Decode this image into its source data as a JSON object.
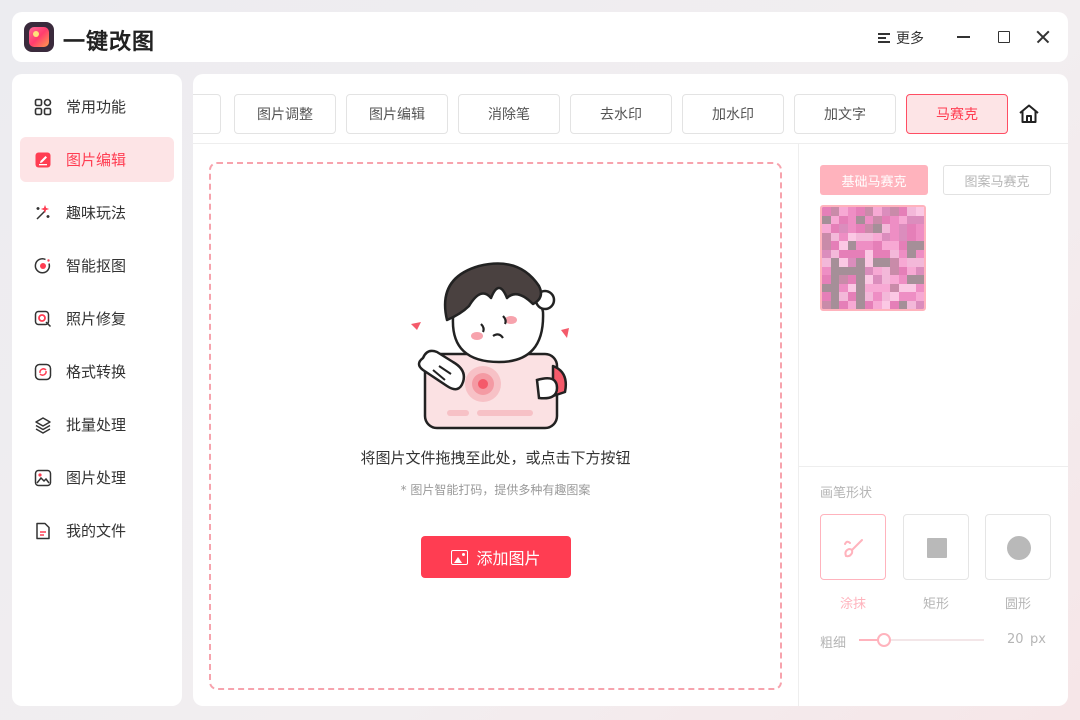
{
  "app": {
    "title": "一键改图"
  },
  "titlebar": {
    "more_label": "更多"
  },
  "sidebar": {
    "items": [
      {
        "label": "常用功能",
        "icon": "grid-icon",
        "active": false
      },
      {
        "label": "图片编辑",
        "icon": "edit-icon",
        "active": true
      },
      {
        "label": "趣味玩法",
        "icon": "magic-wand-icon",
        "active": false
      },
      {
        "label": "智能抠图",
        "icon": "target-icon",
        "active": false
      },
      {
        "label": "照片修复",
        "icon": "photo-repair-icon",
        "active": false
      },
      {
        "label": "格式转换",
        "icon": "convert-icon",
        "active": false
      },
      {
        "label": "批量处理",
        "icon": "layers-icon",
        "active": false
      },
      {
        "label": "图片处理",
        "icon": "image-icon",
        "active": false
      },
      {
        "label": "我的文件",
        "icon": "file-icon",
        "active": false
      }
    ]
  },
  "toolbar": {
    "tabs": [
      {
        "label": ""
      },
      {
        "label": "图片调整"
      },
      {
        "label": "图片编辑"
      },
      {
        "label": "消除笔"
      },
      {
        "label": "去水印"
      },
      {
        "label": "加水印"
      },
      {
        "label": "加文字"
      },
      {
        "label": "马赛克"
      }
    ],
    "active_tab": "马赛克"
  },
  "dropzone": {
    "text": "将图片文件拖拽至此处，或点击下方按钮",
    "subtext": "* 图片智能打码，提供多种有趣图案",
    "add_button_label": "添加图片"
  },
  "mosaic_panel": {
    "tabs": [
      "基础马赛克",
      "图案马赛克"
    ],
    "active_tab": "基础马赛克",
    "brush_shape_label": "画笔形状",
    "shapes": [
      {
        "label": "涂抹",
        "icon": "brush-icon",
        "active": true
      },
      {
        "label": "矩形",
        "icon": "square-icon",
        "active": false
      },
      {
        "label": "圆形",
        "icon": "circle-icon",
        "active": false
      }
    ],
    "size_label": "粗细",
    "size_value": "20",
    "size_unit": "px",
    "size_fraction": 0.2
  },
  "colors": {
    "accent": "#ff3d52",
    "accent_light": "#fde4e6",
    "accent_soft": "#ffb3bd"
  }
}
